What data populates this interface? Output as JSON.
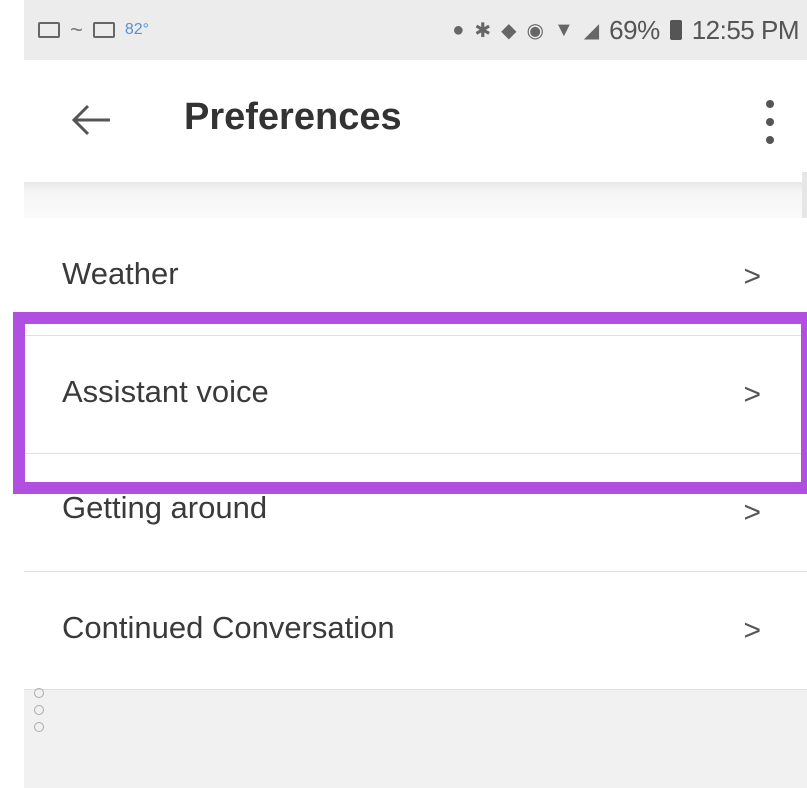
{
  "status_bar": {
    "temperature": "82°",
    "battery": "69%",
    "time": "12:55 PM"
  },
  "header": {
    "title": "Preferences"
  },
  "preferences": [
    {
      "label": "Weather"
    },
    {
      "label": "Assistant voice"
    },
    {
      "label": "Getting around"
    },
    {
      "label": "Continued Conversation"
    }
  ],
  "colors": {
    "highlight": "#b04fe0",
    "status_bar_bg": "#ececec",
    "footer_bg": "#f1f1f1"
  },
  "icons": {
    "back": "arrow-left-icon",
    "more": "more-vertical-icon",
    "row": "chevron-right-icon"
  }
}
